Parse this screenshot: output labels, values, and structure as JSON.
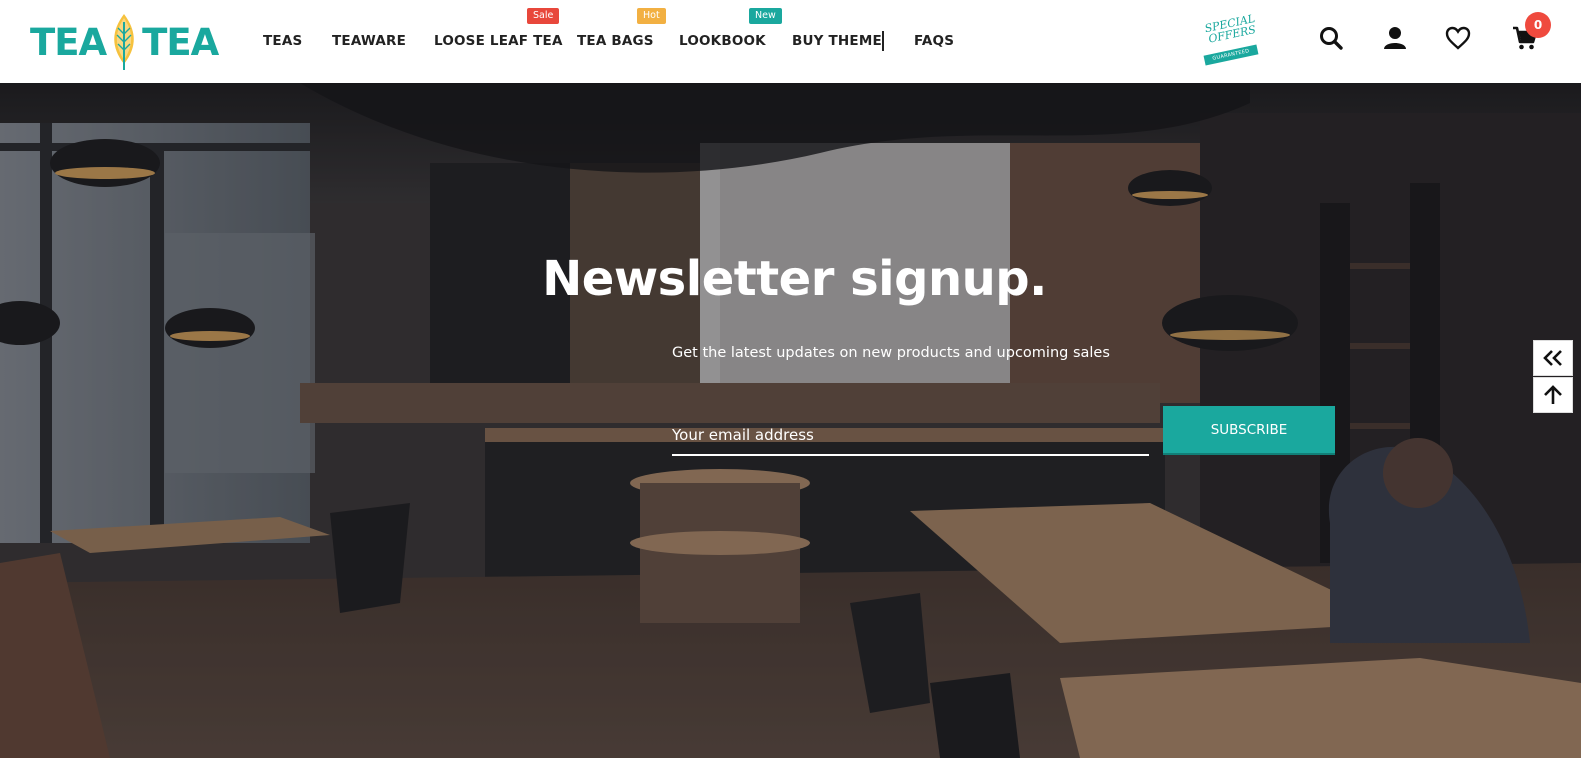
{
  "logo": {
    "left": "TEA",
    "right": "TEA"
  },
  "nav": {
    "items": [
      {
        "label": "TEAS"
      },
      {
        "label": "TEAWARE"
      },
      {
        "label": "LOOSE LEAF TEA",
        "badge": "Sale",
        "badge_color": "#e8473b"
      },
      {
        "label": "TEA BAGS",
        "badge": "Hot",
        "badge_color": "#f2b042"
      },
      {
        "label": "LOOKBOOK",
        "badge": "New",
        "badge_color": "#1aa89e"
      },
      {
        "label": "BUY THEME"
      },
      {
        "label": "FAQS"
      }
    ]
  },
  "promo": {
    "line1": "SPECIAL",
    "line2": "OFFERS",
    "ribbon": "GUARANTEED"
  },
  "header_icons": [
    "search-icon",
    "user-icon",
    "heart-icon",
    "cart-icon"
  ],
  "cart": {
    "count": "0"
  },
  "newsletter": {
    "title": "Newsletter signup.",
    "subtitle": "Get the latest updates on new products and upcoming sales",
    "email_placeholder": "Your email address",
    "subscribe_label": "SUBSCRIBE"
  },
  "colors": {
    "accent": "#1aa89e",
    "sale": "#e8473b",
    "hot": "#f2b042",
    "cart_badge": "#ef4a3e"
  }
}
